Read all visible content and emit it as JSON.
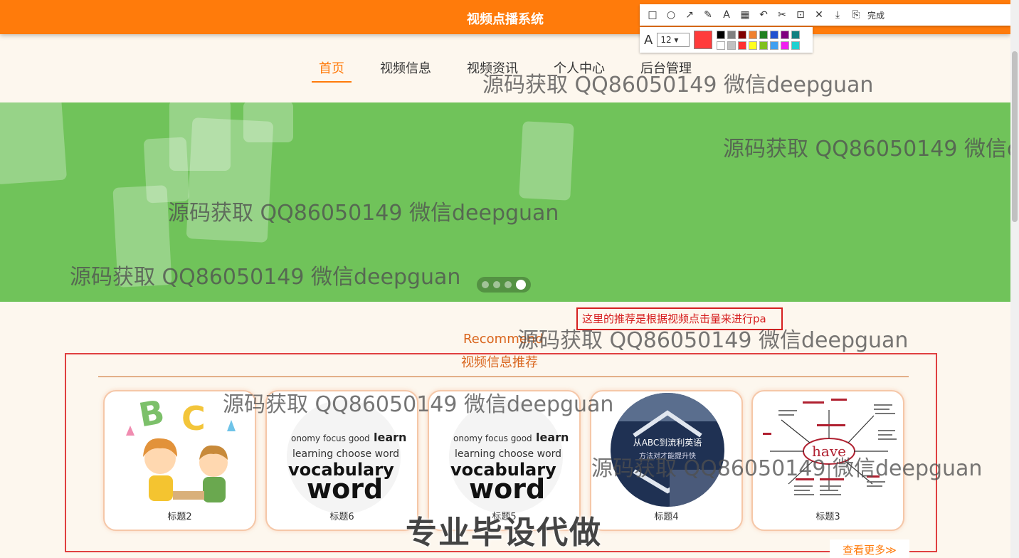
{
  "header": {
    "title": "视频点播系统"
  },
  "nav": {
    "items": [
      {
        "label": "首页",
        "active": true
      },
      {
        "label": "视频信息"
      },
      {
        "label": "视频资讯"
      },
      {
        "label": "个人中心"
      },
      {
        "label": "后台管理"
      }
    ]
  },
  "banner": {
    "slide_count": 4,
    "active_slide": 4,
    "color": "#70c35a"
  },
  "annotation": {
    "text": "这里的推荐是根据视频点击量来进行pa"
  },
  "section": {
    "title_en": "Recommend",
    "title_cn": "视频信息推荐",
    "more_label": "查看更多≫"
  },
  "cards": [
    {
      "caption": "标题2"
    },
    {
      "caption": "标题6"
    },
    {
      "caption": "标题5"
    },
    {
      "caption": "标题4",
      "overlay_line1": "从ABC到流利英语",
      "overlay_line2": "方法对才能提升快"
    },
    {
      "caption": "标题3",
      "center_word": "have"
    }
  ],
  "watermark": {
    "text": "源码获取 QQ86050149 微信deepguan",
    "big_text": "专业毕设代做"
  },
  "screenshot_toolbar": {
    "font_size": "12",
    "current_color": "#ff3b3b",
    "finish_label": "完成",
    "palette": [
      "#000000",
      "#808080",
      "#800000",
      "#f08030",
      "#208020",
      "#2050d0",
      "#800080",
      "#108080",
      "#ffffff",
      "#c0c0c0",
      "#ff3030",
      "#ffff20",
      "#80c020",
      "#40a0f0",
      "#f020f0",
      "#20d0d0"
    ]
  },
  "colors": {
    "brand": "#ff7b0b",
    "accent_text": "#d9651d",
    "frame": "#e04040"
  }
}
